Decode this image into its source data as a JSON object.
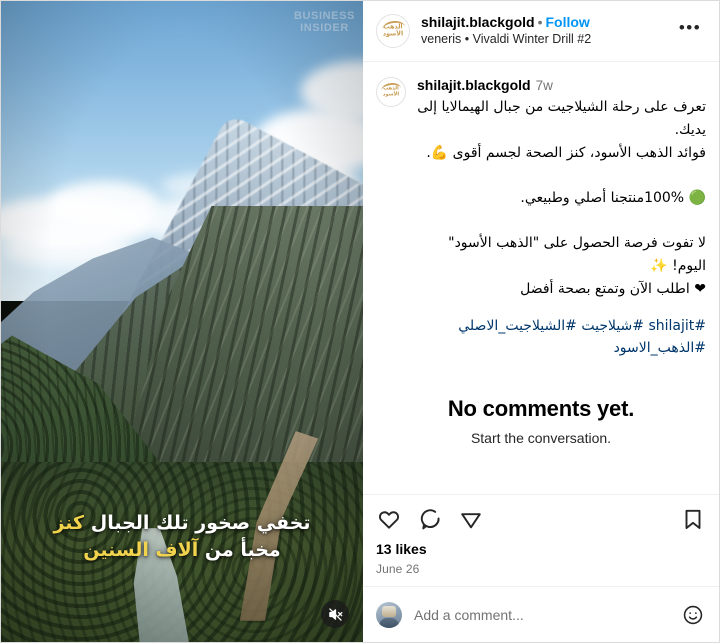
{
  "post": {
    "header": {
      "username": "shilajit.blackgold",
      "separator": "•",
      "follow_label": "Follow",
      "audio_line": "veneris • Vivaldi Winter Drill #2",
      "avatar_mark": "الذهب الأسود",
      "more_label": "•••"
    },
    "media": {
      "watermark_line1": "BUSINESS",
      "watermark_line2": "INSIDER",
      "overlay_line1_a": "تخفي صخور تلك الجبال ",
      "overlay_line1_b": "كنز",
      "overlay_line2_a": "مخبأ من ",
      "overlay_line2_b": "آلاف السنين",
      "mute_icon": "speaker-muted-icon"
    },
    "caption": {
      "username": "shilajit.blackgold",
      "age": "7w",
      "avatar_mark": "الذهب الأسود",
      "text": "تعرف على رحلة الشيلاجيت من جبال الهيمالايا إلى يديك.\nفوائد الذهب الأسود، كنز الصحة لجسم أقوى 💪.\n\n🟢 100%منتجنا أصلي وطبيعي.\n\nلا تفوت فرصة الحصول على \"الذهب الأسود\" اليوم! ✨\n❤ اطلب الآن وتمتع بصحة أفضل",
      "hashtags": "#shilajit #شيلاجيت #الشيلاجيت_الاصلي #الذهب_الاسود"
    },
    "comments_empty": {
      "title": "No comments yet.",
      "subtitle": "Start the conversation."
    },
    "actions": {
      "like_icon": "heart-icon",
      "comment_icon": "comment-bubble-icon",
      "share_icon": "share-paperplane-icon",
      "save_icon": "bookmark-icon",
      "likes": "13 likes",
      "date": "June 26"
    },
    "add_comment": {
      "placeholder": "Add a comment...",
      "emoji_icon": "emoji-smiley-icon"
    },
    "colors": {
      "link_blue": "#0095f6",
      "hashtag_blue": "#00376b",
      "text_primary": "#262626",
      "text_secondary": "#737373",
      "highlight_yellow": "#f2d34e"
    }
  }
}
